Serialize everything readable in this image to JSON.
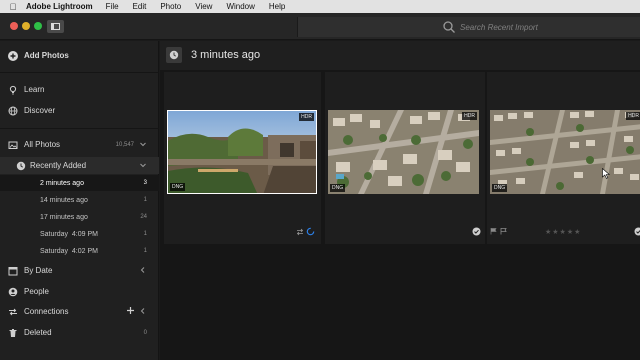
{
  "menubar": {
    "app_name": "Adobe Lightroom",
    "items": [
      "File",
      "Edit",
      "Photo",
      "View",
      "Window",
      "Help"
    ]
  },
  "search": {
    "placeholder": "Search Recent Import"
  },
  "sidebar": {
    "add_photos": "Add Photos",
    "learn": "Learn",
    "discover": "Discover",
    "all_photos": {
      "label": "All Photos",
      "count": "10,547"
    },
    "recently_added": {
      "label": "Recently Added"
    },
    "recent_items": [
      {
        "label": "2 minutes ago",
        "count": "3"
      },
      {
        "label": "14 minutes ago",
        "count": "1"
      },
      {
        "label": "17 minutes ago",
        "count": "24"
      },
      {
        "label": "Saturday  4:09 PM",
        "count": "1"
      },
      {
        "label": "Saturday  4:02 PM",
        "count": "1"
      }
    ],
    "by_date": "By Date",
    "people": "People",
    "connections": "Connections",
    "deleted": {
      "label": "Deleted",
      "count": "0"
    }
  },
  "main": {
    "group_title": "3 minutes ago",
    "photos": [
      {
        "hdr_badge": "HDR",
        "format_badge": "DNG"
      },
      {
        "hdr_badge": "HDR",
        "format_badge": "DNG"
      },
      {
        "hdr_badge": "HDR",
        "format_badge": "DNG",
        "rating_max": 5,
        "rating": 0
      }
    ]
  },
  "colors": {
    "accent_blue": "#2d7fe6",
    "traffic_red": "#ed5f57",
    "traffic_yellow": "#e0b02a",
    "traffic_green": "#2fbf47"
  }
}
